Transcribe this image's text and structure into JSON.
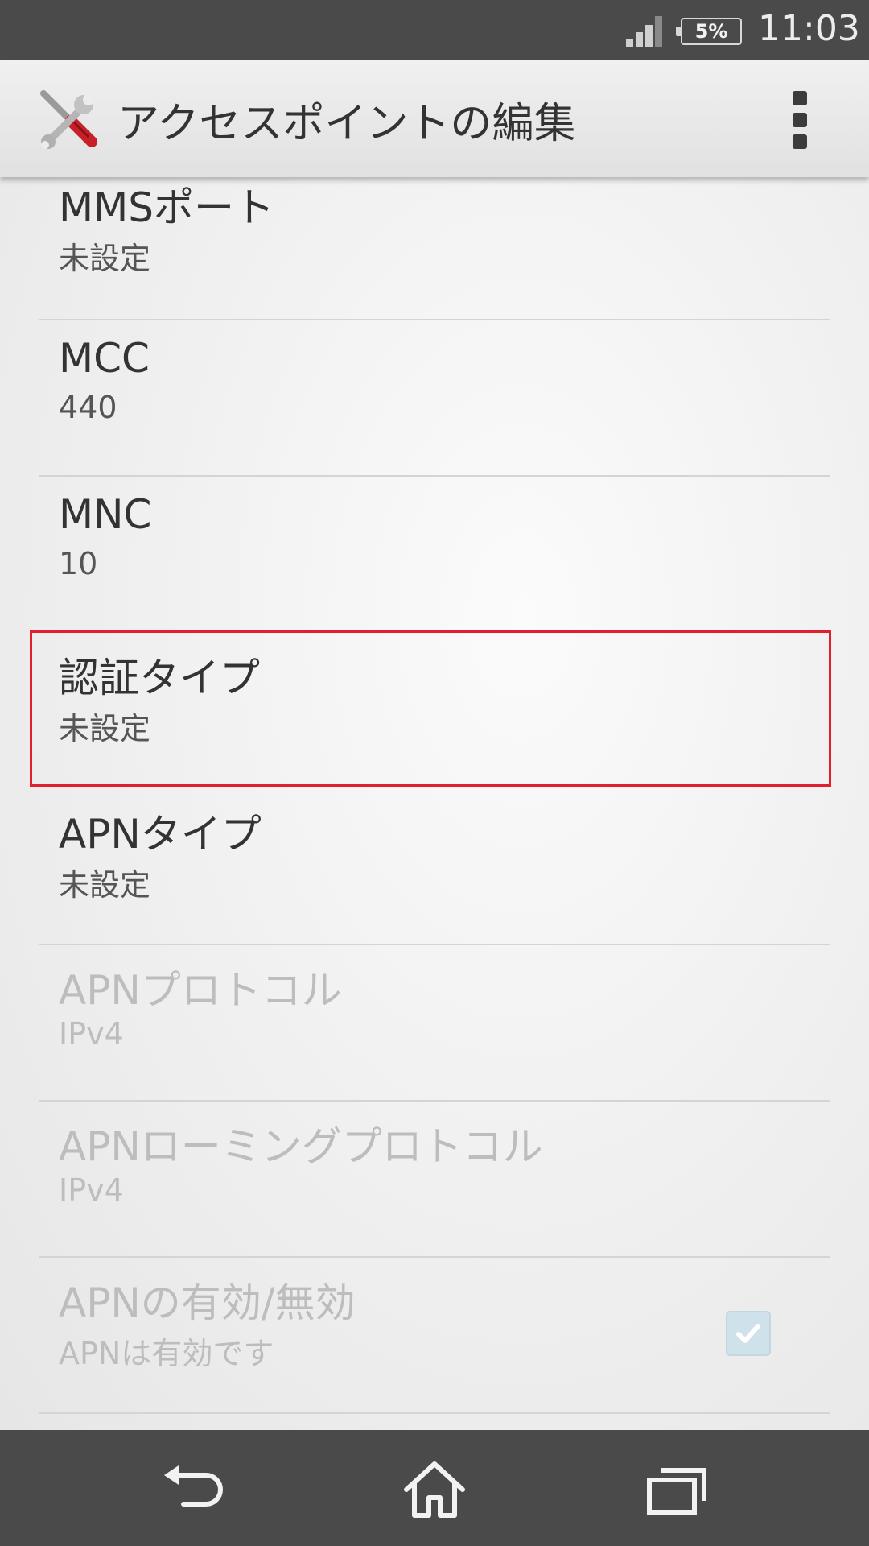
{
  "status_bar": {
    "battery_text": "5%",
    "time": "11:03"
  },
  "action_bar": {
    "title": "アクセスポイントの編集",
    "app_icon": "tools-icon",
    "menu_icon": "overflow-menu-icon"
  },
  "settings": [
    {
      "label": "MMSポート",
      "value": "未設定"
    },
    {
      "label": "MCC",
      "value": "440"
    },
    {
      "label": "MNC",
      "value": "10"
    },
    {
      "label": "認証タイプ",
      "value": "未設定"
    },
    {
      "label": "APNタイプ",
      "value": "未設定"
    },
    {
      "label": "APNプロトコル",
      "value": "IPv4"
    },
    {
      "label": "APNローミングプロトコル",
      "value": "IPv4"
    },
    {
      "label": "APNの有効/無効",
      "value": "APNは有効です"
    }
  ],
  "nav_bar": {
    "back": "back-icon",
    "home": "home-icon",
    "recents": "recents-icon"
  },
  "colors": {
    "highlight": "#e0202c",
    "status_bar": "#4a4a4a",
    "disabled_text": "#bdbdbd"
  }
}
